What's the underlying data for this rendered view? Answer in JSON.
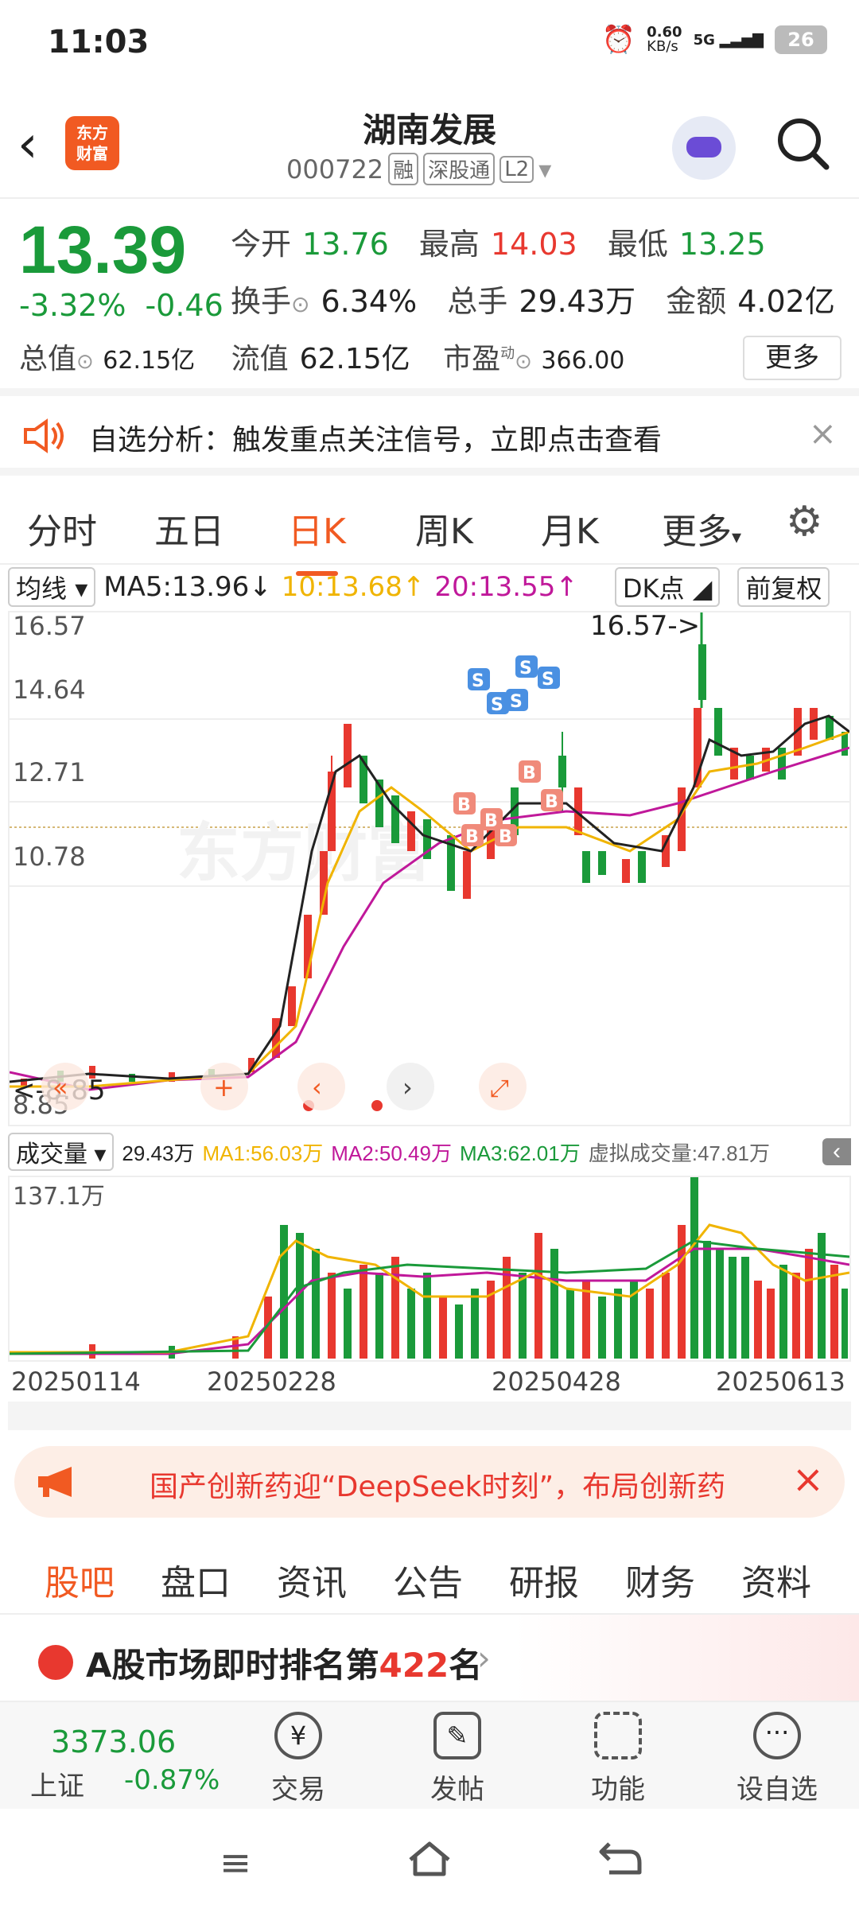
{
  "status": {
    "time": "11:03",
    "net_speed": "0.60",
    "net_unit": "KB/s",
    "signal": "5G",
    "battery": "26"
  },
  "header": {
    "back": "‹",
    "logo_line1": "东方",
    "logo_line2": "财富",
    "title": "湖南发展",
    "code": "000722",
    "tags": [
      "融",
      "深股通",
      "L2"
    ]
  },
  "quote": {
    "price": "13.39",
    "change_pct": "-3.32%",
    "change": "-0.46",
    "rows": [
      [
        {
          "label": "今开",
          "value": "13.76",
          "color": "down"
        },
        {
          "label": "最高",
          "value": "14.03",
          "color": "up"
        },
        {
          "label": "最低",
          "value": "13.25",
          "color": "down"
        }
      ],
      [
        {
          "label": "换手",
          "value": "6.34%",
          "color": "none"
        },
        {
          "label": "总手",
          "value": "29.43万",
          "color": "none"
        },
        {
          "label": "金额",
          "value": "4.02亿",
          "color": "none"
        }
      ]
    ],
    "total_value_label": "总值",
    "total_value": "62.15亿",
    "float_value_label": "流值",
    "float_value": "62.15亿",
    "pe_label": "市盈",
    "pe_sup": "动",
    "pe_value": "366.00",
    "more": "更多"
  },
  "alert": {
    "text": "自选分析：触发重点关注信号，立即点击查看",
    "close": "×"
  },
  "tabs": [
    "分时",
    "五日",
    "日K",
    "周K",
    "月K",
    "更多"
  ],
  "active_tab": 2,
  "ma_line": {
    "selector": "均线",
    "ma5": "MA5:13.96",
    "ma5_arrow": "↓",
    "ma10": "10:13.68",
    "ma10_arrow": "↑",
    "ma20": "20:13.55",
    "ma20_arrow": "↑",
    "dk": "DK点",
    "adjust": "前复权"
  },
  "kchart": {
    "y_labels": [
      "16.57",
      "14.64",
      "12.71",
      "10.78",
      "8.85"
    ],
    "max_label": "16.57->",
    "min_label": "<-8.85",
    "watermark": "东方财富"
  },
  "volume": {
    "selector": "成交量",
    "vol": "29.43万",
    "ma1": "MA1:56.03万",
    "ma2": "MA2:50.49万",
    "ma3": "MA3:62.01万",
    "virtual": "虚拟成交量:47.81万",
    "max_label": "137.1万"
  },
  "dates": [
    "20250114",
    "20250228",
    "20250428",
    "20250613"
  ],
  "colors": {
    "up": "#e8382f",
    "down": "#1a9a3a",
    "accent": "#f15a22",
    "ma5": "#222222",
    "ma10": "#f0b400",
    "ma20": "#c0189a"
  },
  "banner": {
    "text": "国产创新药迎“DeepSeek时刻”，布局创新药",
    "close": "×"
  },
  "subtabs": [
    "股吧",
    "盘口",
    "资讯",
    "公告",
    "研报",
    "财务",
    "资料"
  ],
  "rank": {
    "prefix": "A股市场即时排名第",
    "number": "422",
    "suffix": "名"
  },
  "bottom": {
    "index_value": "3373.06",
    "index_name": "上证",
    "index_pct": "-0.87%",
    "items": [
      {
        "label": "交易",
        "icon": "yen-icon"
      },
      {
        "label": "发帖",
        "icon": "edit-icon"
      },
      {
        "label": "功能",
        "icon": "grid-icon"
      },
      {
        "label": "设自选",
        "icon": "more-icon"
      }
    ]
  }
}
